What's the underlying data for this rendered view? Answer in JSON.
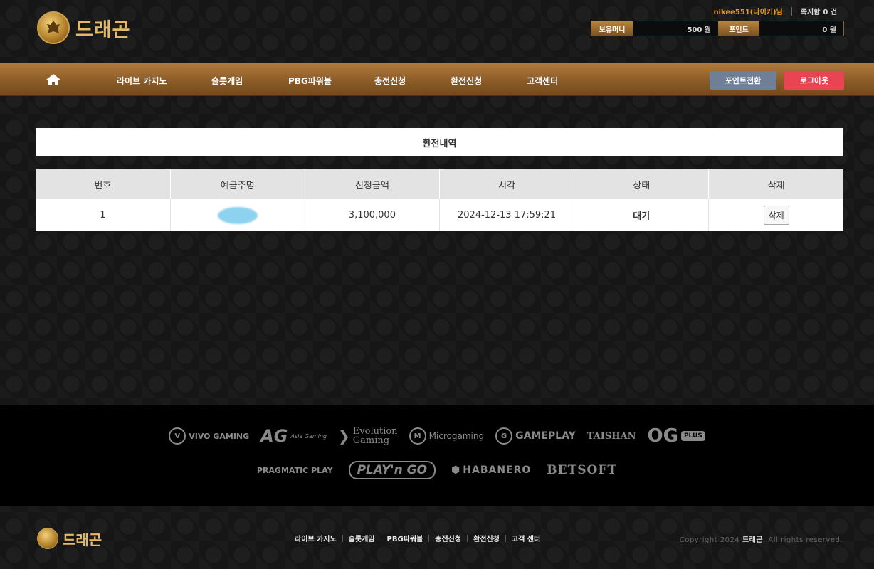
{
  "brand": {
    "name": "드래곤"
  },
  "user": {
    "name": "nikee551(나이키)님",
    "messages_label": "쪽지함",
    "messages_count": "0 건"
  },
  "balance": {
    "money_label": "보유머니",
    "money_value": "500 원",
    "point_label": "포인트",
    "point_value": "0 원"
  },
  "nav": {
    "items": [
      {
        "label": "라이브 카지노"
      },
      {
        "label": "슬롯게임"
      },
      {
        "label": "PBG파워볼"
      },
      {
        "label": "충전신청"
      },
      {
        "label": "환전신청"
      },
      {
        "label": "고객센터"
      }
    ],
    "point_convert_label": "포인트전환",
    "logout_label": "로그아웃"
  },
  "page": {
    "title": "환전내역"
  },
  "table": {
    "headers": [
      "번호",
      "예금주명",
      "신청금액",
      "시각",
      "상태",
      "삭제"
    ],
    "rows": [
      {
        "no": "1",
        "amount": "3,100,000",
        "time": "2024-12-13 17:59:21",
        "status": "대기",
        "delete_label": "삭제"
      }
    ]
  },
  "partners": {
    "vivo": "VIVO GAMING",
    "ag": "AG",
    "ag_sub": "Asia Gaming",
    "evolution": "Evolution",
    "evolution_sub": "Gaming",
    "microgaming": "Microgaming",
    "gameplay": "GAMEPLAY",
    "taishan": "TAISHAN",
    "og": "OG",
    "og_plus": "PLUS",
    "pragmatic": "PRAGMATIC PLAY",
    "playngo": "PLAY'n GO",
    "habanero": "HABANERO",
    "betsoft": "BETSOFT"
  },
  "footer": {
    "links": [
      "라이브 카지노",
      "슬롯게임",
      "PBG파워볼",
      "충전신청",
      "환전신청",
      "고객 센터"
    ],
    "copyright_prefix": "Copyright 2024",
    "copyright_brand": "드래곤",
    "copyright_suffix": ". All rights reserved."
  }
}
